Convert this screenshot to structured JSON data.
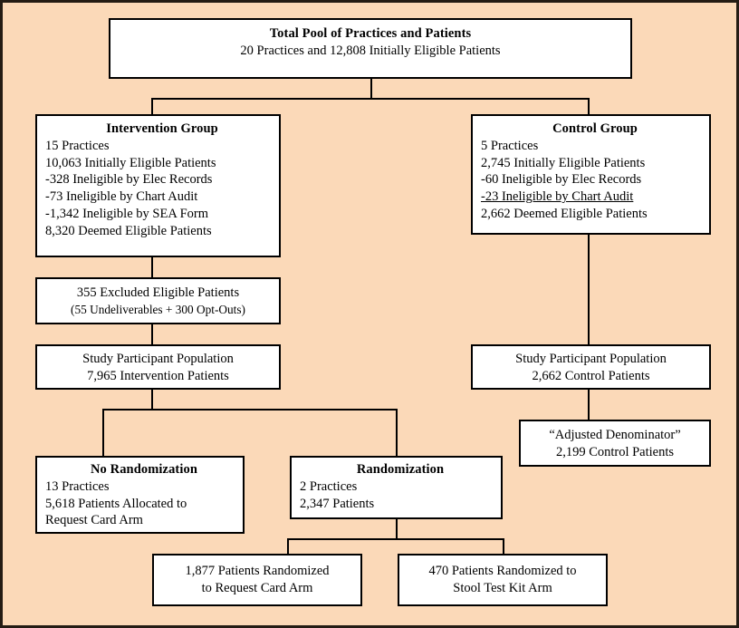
{
  "figure": {
    "type": "flowchart",
    "background_color": "#fbd9b8",
    "box_fill_color": "#ffffff",
    "border_color": "#000000"
  },
  "nodes": {
    "total_pool": {
      "title": "Total Pool of Practices and Patients",
      "lines": [
        "20 Practices and 12,808 Initially Eligible Patients"
      ]
    },
    "intervention_group": {
      "title": "Intervention Group",
      "lines": [
        "15 Practices",
        "10,063 Initially Eligible Patients",
        "-328 Ineligible by Elec Records",
        "-73 Ineligible by Chart Audit",
        "-1,342 Ineligible by SEA Form",
        "8,320 Deemed Eligible Patients"
      ]
    },
    "control_group": {
      "title": "Control Group",
      "lines": [
        "5 Practices",
        "2,745 Initially Eligible Patients",
        "-60 Ineligible by Elec Records",
        "-23 Ineligible by Chart Audit",
        "2,662 Deemed Eligible Patients"
      ]
    },
    "excluded": {
      "line1": "355 Excluded Eligible Patients",
      "line2": "(55 Undeliverables + 300 Opt-Outs)"
    },
    "study_pop_intervention": {
      "line1": "Study Participant Population",
      "line2": "7,965 Intervention Patients"
    },
    "study_pop_control": {
      "line1": "Study Participant Population",
      "line2": "2,662 Control Patients"
    },
    "adjusted_denominator": {
      "line1": "“Adjusted Denominator”",
      "line2": "2,199 Control Patients"
    },
    "no_randomization": {
      "title": "No Randomization",
      "lines": [
        "13 Practices",
        "5,618 Patients Allocated to",
        "Request Card Arm"
      ]
    },
    "randomization": {
      "title": "Randomization",
      "lines": [
        "2 Practices",
        "2,347 Patients"
      ]
    },
    "request_card_arm": {
      "line1": "1,877 Patients Randomized",
      "line2": "to Request Card Arm"
    },
    "stool_test_kit_arm": {
      "line1": "470 Patients Randomized to",
      "line2": "Stool Test Kit Arm"
    }
  }
}
